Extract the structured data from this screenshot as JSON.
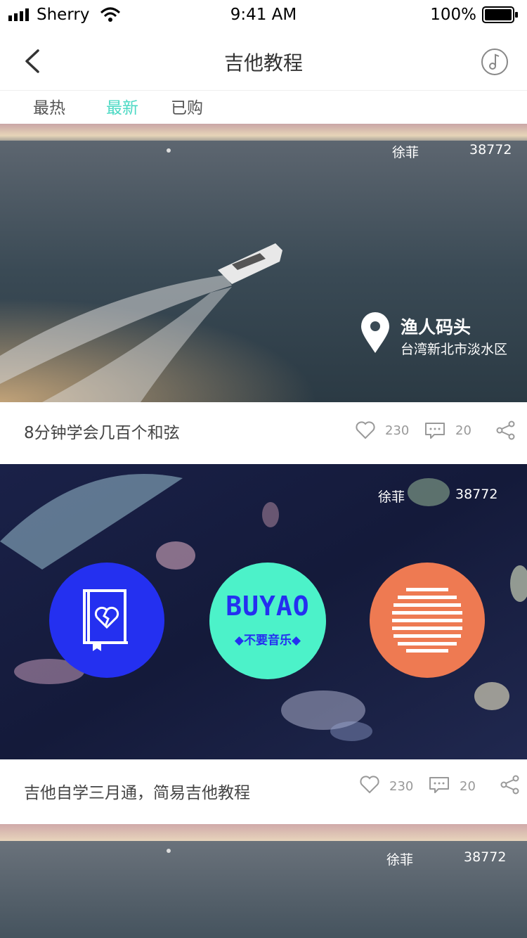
{
  "status_bar": {
    "carrier": "Sherry",
    "time": "9:41 AM",
    "battery": "100%"
  },
  "nav": {
    "title": "吉他教程"
  },
  "tabs": [
    {
      "label": "最热",
      "active": false
    },
    {
      "label": "最新",
      "active": true
    },
    {
      "label": "已购",
      "active": false
    }
  ],
  "cards": [
    {
      "author": "徐菲",
      "views": "38772",
      "location_name": "渔人码头",
      "location_area": "台湾新北市淡水区",
      "title": "8分钟学会几百个和弦",
      "likes": "230",
      "comments": "20"
    },
    {
      "author": "徐菲",
      "views": "38772",
      "logo_big": "BUYAO",
      "logo_small": "◆不要音乐◆",
      "title": "吉他自学三月通，简易吉他教程",
      "likes": "230",
      "comments": "20"
    },
    {
      "author": "徐菲",
      "views": "38772"
    }
  ],
  "colors": {
    "accent": "#4dd9c4",
    "blue_circle": "#2430f0",
    "teal_circle": "#4cf2c9",
    "orange_circle": "#ee7a52"
  }
}
